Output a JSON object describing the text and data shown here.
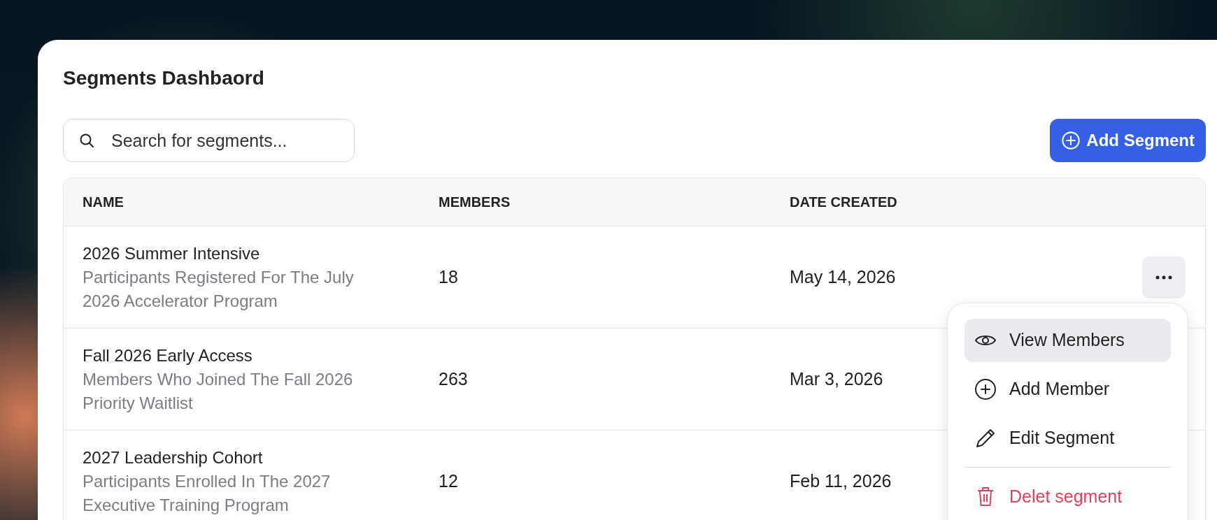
{
  "title": "Segments Dashbaord",
  "search": {
    "placeholder": "Search for segments..."
  },
  "add_button": {
    "label": "Add Segment"
  },
  "table": {
    "columns": [
      "NAME",
      "MEMBERS",
      "DATE CREATED"
    ],
    "rows": [
      {
        "name": "2026 Summer Intensive",
        "description": "Participants Registered For The July 2026 Accelerator Program",
        "members": "18",
        "date_created": "May 14, 2026",
        "menu_open": true
      },
      {
        "name": "Fall 2026 Early Access",
        "description": "Members Who Joined The Fall 2026 Priority Waitlist",
        "members": "263",
        "date_created": "Mar 3, 2026",
        "menu_open": false
      },
      {
        "name": "2027 Leadership Cohort",
        "description": "Participants Enrolled In The 2027 Executive Training Program",
        "members": "12",
        "date_created": "Feb 11, 2026",
        "menu_open": false
      }
    ]
  },
  "row_menu": {
    "items": [
      {
        "label": "View Members",
        "kind": "normal",
        "selected": true
      },
      {
        "label": "Add Member",
        "kind": "normal",
        "selected": false
      },
      {
        "label": "Edit Segment",
        "kind": "normal",
        "selected": false
      },
      {
        "label": "Delet segment",
        "kind": "danger",
        "selected": false
      }
    ]
  }
}
